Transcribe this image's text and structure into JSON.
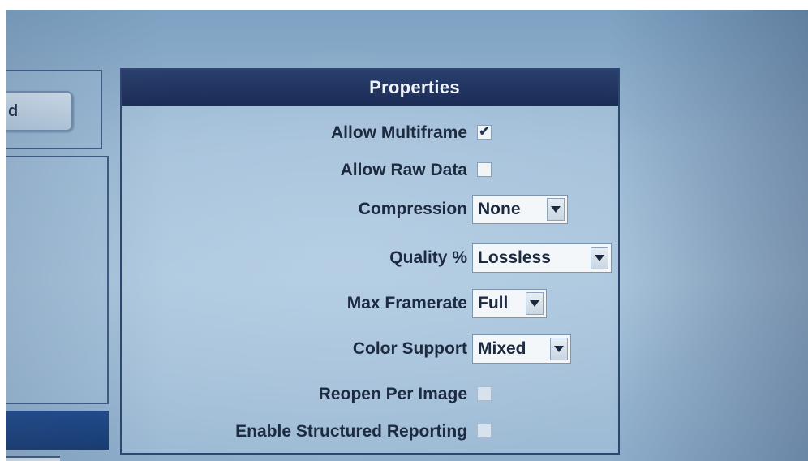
{
  "left_panel": {
    "button_label": "d"
  },
  "properties": {
    "title": "Properties",
    "allow_multiframe": {
      "label": "Allow Multiframe",
      "checked": true,
      "mark": "✔"
    },
    "allow_raw_data": {
      "label": "Allow Raw Data",
      "checked": false
    },
    "compression": {
      "label": "Compression",
      "value": "None",
      "icon": "chevron-down-icon"
    },
    "quality": {
      "label": "Quality %",
      "value": "Lossless",
      "icon": "chevron-down-icon"
    },
    "max_framerate": {
      "label": "Max Framerate",
      "value": "Full",
      "icon": "chevron-down-icon"
    },
    "color_support": {
      "label": "Color Support",
      "value": "Mixed",
      "icon": "chevron-down-icon"
    },
    "reopen_per_image": {
      "label": "Reopen Per Image",
      "checked": false
    },
    "enable_structured_reporting": {
      "label": "Enable Structured Reporting",
      "checked": false
    }
  },
  "colors": {
    "header_bg": "#1b2c55",
    "panel_border": "#2d4670",
    "left_selection_bar": "#1f4a8c"
  }
}
